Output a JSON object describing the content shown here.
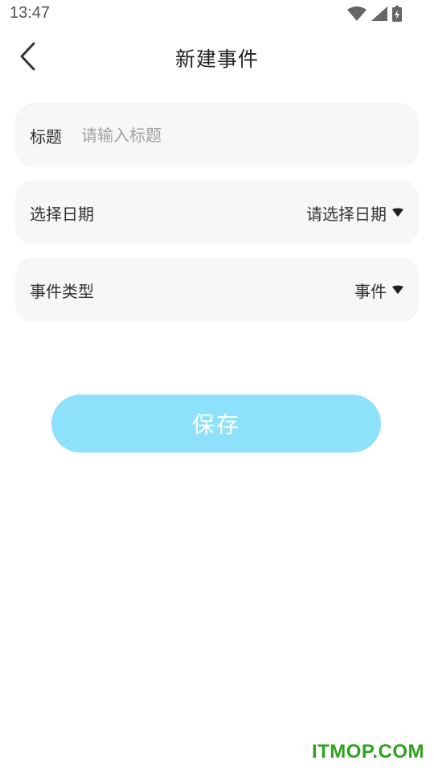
{
  "status_bar": {
    "time": "13:47",
    "icons": [
      "wifi-icon",
      "cellular-signal-icon",
      "battery-charging-icon"
    ]
  },
  "app_bar": {
    "back_icon": "chevron-left-icon",
    "title": "新建事件"
  },
  "form": {
    "title_field": {
      "label": "标题",
      "placeholder": "请输入标题",
      "value": ""
    },
    "date_field": {
      "label": "选择日期",
      "value": "请选择日期",
      "icon": "caret-down-icon"
    },
    "type_field": {
      "label": "事件类型",
      "value": "事件",
      "icon": "caret-down-icon"
    }
  },
  "save_button": {
    "label": "保存"
  },
  "watermark": "ITMOP.COM",
  "colors": {
    "accent": "#8ee1fb",
    "card_background": "#f7f7f7",
    "watermark": "#2fa21f"
  }
}
